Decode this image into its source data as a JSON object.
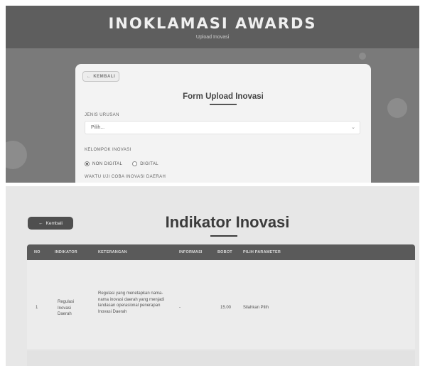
{
  "top": {
    "banner_title": "INOKLAMASI AWARDS",
    "banner_subtitle": "Upload Inovasi",
    "back_label": "KEMBALI",
    "form_title": "Form Upload Inovasi",
    "jenis_urusan_label": "JENIS URUSAN",
    "jenis_urusan_value": "Pilih...",
    "kelompok_label": "KELOMPOK INOVASI",
    "kelompok_options": [
      "NON DIGITAL",
      "DIGITAL"
    ],
    "kelompok_selected": "NON DIGITAL",
    "waktu_label": "WAKTU UJI COBA INOVASI DAERAH"
  },
  "bottom": {
    "back_label": "Kembali",
    "title": "Indikator Inovasi",
    "columns": [
      "NO",
      "INDIKATOR",
      "KETERANGAN",
      "INFORMASI",
      "BOBOT",
      "PILIH PARAMETER"
    ],
    "rows": [
      {
        "no": "1",
        "indikator": "Regulasi Inovasi Daerah",
        "keterangan": "Regulasi yang menetapkan nama-nama inovasi daerah yang menjadi landasan operasional penerapan Inovasi Daerah",
        "informasi": "-",
        "bobot": "15.00",
        "parameter": "Silahkan Pilih"
      }
    ]
  },
  "colors": {
    "banner_bg": "#5e5e5e",
    "table_header_bg": "#5a5a5a",
    "back_button_bg": "#4f4f4f"
  }
}
